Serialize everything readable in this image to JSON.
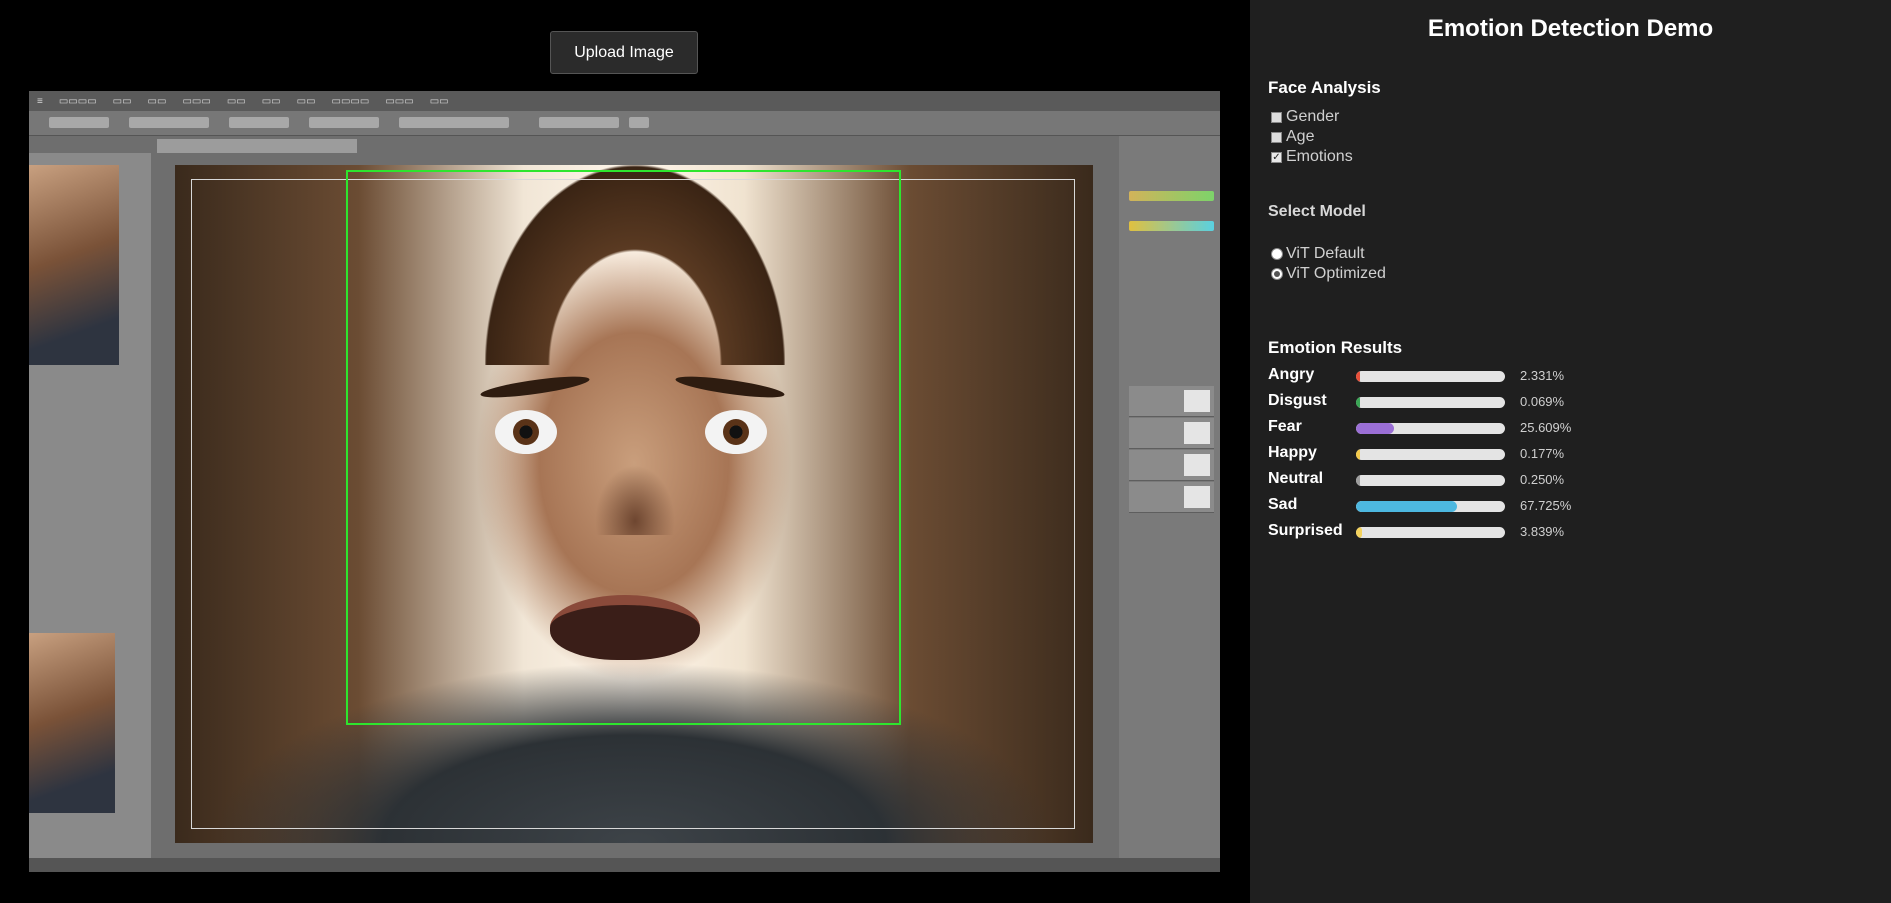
{
  "upload": {
    "label": "Upload Image"
  },
  "panel": {
    "title": "Emotion Detection Demo",
    "face_analysis": {
      "heading": "Face Analysis",
      "options": [
        {
          "label": "Gender",
          "checked": false
        },
        {
          "label": "Age",
          "checked": false
        },
        {
          "label": "Emotions",
          "checked": true
        }
      ]
    },
    "model": {
      "heading": "Select Model",
      "options": [
        {
          "label": "ViT Default",
          "selected": false
        },
        {
          "label": "ViT Optimized",
          "selected": true
        }
      ]
    },
    "results": {
      "heading": "Emotion Results",
      "items": [
        {
          "label": "Angry",
          "value": "2.331%",
          "fraction": 0.02331,
          "color": "#e8503a"
        },
        {
          "label": "Disgust",
          "value": "0.069%",
          "fraction": 0.00069,
          "color": "#3aa655"
        },
        {
          "label": "Fear",
          "value": "25.609%",
          "fraction": 0.25609,
          "color": "#9b6fd6"
        },
        {
          "label": "Happy",
          "value": "0.177%",
          "fraction": 0.00177,
          "color": "#f2c94c"
        },
        {
          "label": "Neutral",
          "value": "0.250%",
          "fraction": 0.0025,
          "color": "#9e9e9e"
        },
        {
          "label": "Sad",
          "value": "67.725%",
          "fraction": 0.67725,
          "color": "#4db8e0"
        },
        {
          "label": "Surprised",
          "value": "3.839%",
          "fraction": 0.03839,
          "color": "#f4d35e"
        }
      ]
    }
  },
  "colors": {
    "face_box": "#2ee52e",
    "panel_bg": "#1f1f1f"
  }
}
